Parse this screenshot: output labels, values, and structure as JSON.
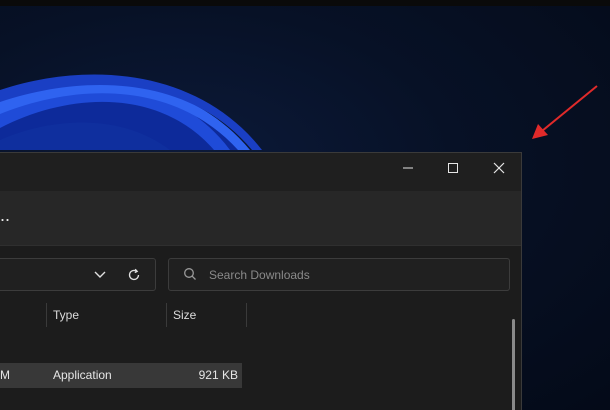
{
  "window": {
    "more_label": "..",
    "search": {
      "placeholder": "Search Downloads"
    },
    "columns": {
      "type": "Type",
      "size": "Size"
    },
    "rows": [
      {
        "name_tail": "M",
        "type": "Application",
        "size": "921 KB"
      }
    ]
  },
  "icons": [
    "minimize-icon",
    "maximize-icon",
    "close-icon",
    "chevron-down-icon",
    "refresh-icon",
    "search-icon"
  ],
  "colors": {
    "window_bg": "#1c1c1c",
    "command_bar_bg": "#272727",
    "selected_row": "#383838",
    "annotation_arrow": "#e02a2a",
    "wallpaper_blue": "#1f4bd8"
  }
}
